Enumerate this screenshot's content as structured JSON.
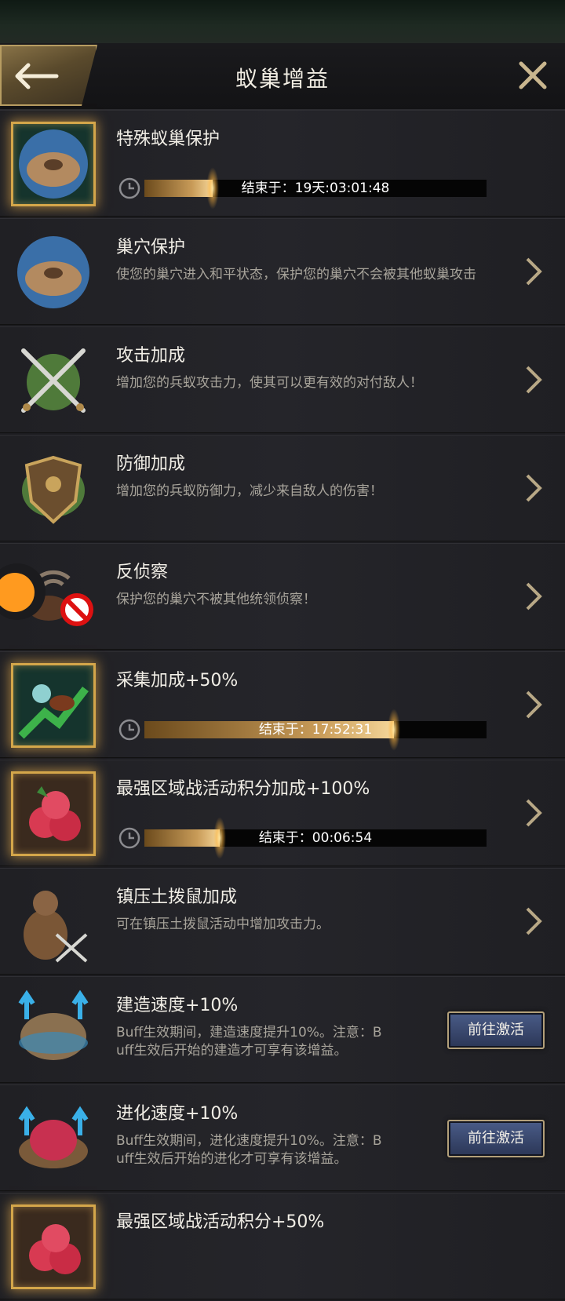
{
  "header": {
    "title": "蚁巢增益"
  },
  "buffs": [
    {
      "name": "特殊蚁巢保护",
      "timer": "结束于：19天:03:01:48",
      "progress": 0.2
    },
    {
      "name": "巢穴保护",
      "desc": "使您的巢穴进入和平状态，保护您的巢穴不会被其他蚁巢攻击"
    },
    {
      "name": "攻击加成",
      "desc": "增加您的兵蚁攻击力，使其可以更有效的对付敌人！"
    },
    {
      "name": "防御加成",
      "desc": "增加您的兵蚁防御力，减少来自敌人的伤害！"
    },
    {
      "name": "反侦察",
      "desc": "保护您的巢穴不被其他统领侦察！"
    },
    {
      "name": "采集加成+50%",
      "timer": "结束于：17:52:31",
      "progress": 0.73
    },
    {
      "name": "最强区域战活动积分加成+100%",
      "timer": "结束于：00:06:54",
      "progress": 0.22
    },
    {
      "name": "镇压土拨鼠加成",
      "desc": "可在镇压土拨鼠活动中增加攻击力。"
    },
    {
      "name": "建造速度+10%",
      "desc": "Buff生效期间，建造速度提升10%。注意：B\nuff生效后开始的建造才可享有该增益。",
      "button": "前往激活"
    },
    {
      "name": "进化速度+10%",
      "desc": "Buff生效期间，进化速度提升10%。注意：B\nuff生效后开始的进化才可享有该增益。",
      "button": "前往激活"
    },
    {
      "name": "最强区域战活动积分+50%"
    }
  ]
}
